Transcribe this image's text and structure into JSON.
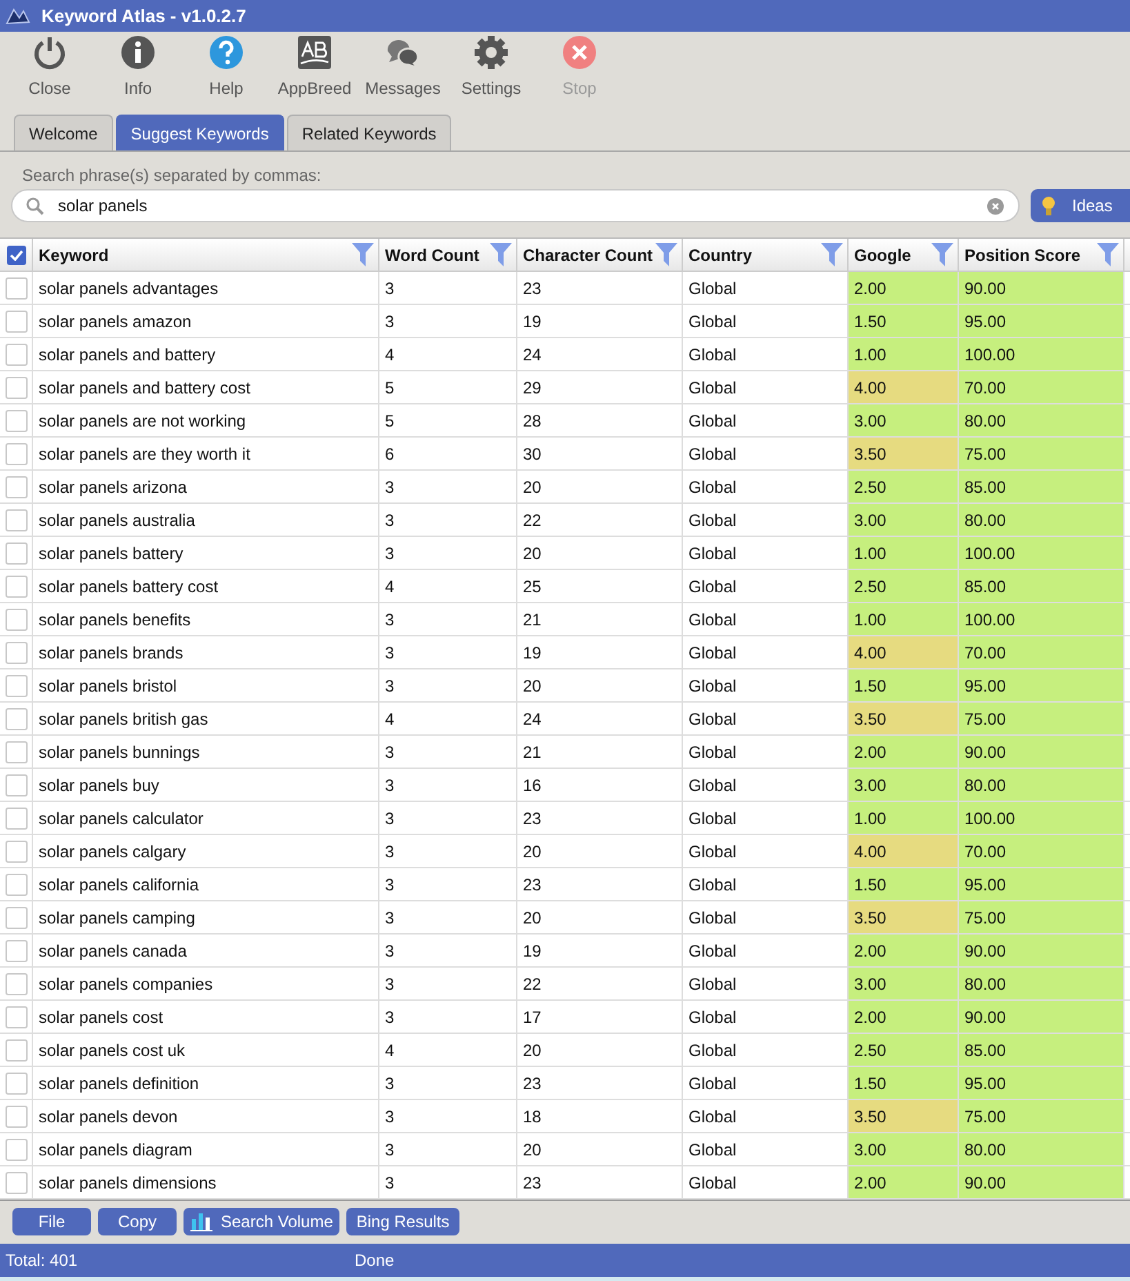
{
  "window": {
    "title": "Keyword Atlas - v1.0.2.7"
  },
  "toolbar": [
    {
      "label": "Close",
      "kind": "power",
      "disabled": false
    },
    {
      "label": "Info",
      "kind": "info",
      "disabled": false
    },
    {
      "label": "Help",
      "kind": "help",
      "disabled": false
    },
    {
      "label": "AppBreed",
      "kind": "appbreed",
      "disabled": false
    },
    {
      "label": "Messages",
      "kind": "messages",
      "disabled": false
    },
    {
      "label": "Settings",
      "kind": "settings",
      "disabled": false
    },
    {
      "label": "Stop",
      "kind": "stop",
      "disabled": true
    }
  ],
  "tabs": [
    {
      "label": "Welcome",
      "selected": false
    },
    {
      "label": "Suggest Keywords",
      "selected": true
    },
    {
      "label": "Related Keywords",
      "selected": false
    }
  ],
  "search": {
    "label": "Search phrase(s) separated by commas:",
    "value": "solar panels",
    "button": "Ideas"
  },
  "table": {
    "all_selected": true,
    "columns": [
      "Keyword",
      "Word Count",
      "Character Count",
      "Country",
      "Google",
      "Position Score"
    ],
    "rows": [
      {
        "selected": false,
        "cells": [
          "solar panels advantages",
          "3",
          "23",
          "Global",
          "2.00",
          "90.00"
        ],
        "color": "#c6ef7e"
      },
      {
        "selected": false,
        "cells": [
          "solar panels amazon",
          "3",
          "19",
          "Global",
          "1.50",
          "95.00"
        ],
        "color": "#c6ef7e"
      },
      {
        "selected": false,
        "cells": [
          "solar panels and battery",
          "4",
          "24",
          "Global",
          "1.00",
          "100.00"
        ],
        "color": "#c6ef7e"
      },
      {
        "selected": false,
        "cells": [
          "solar panels and battery cost",
          "5",
          "29",
          "Global",
          "4.00",
          "70.00"
        ],
        "color": "#e6db80"
      },
      {
        "selected": false,
        "cells": [
          "solar panels are not working",
          "5",
          "28",
          "Global",
          "3.00",
          "80.00"
        ],
        "color": "#c6ef7e"
      },
      {
        "selected": false,
        "cells": [
          "solar panels are they worth it",
          "6",
          "30",
          "Global",
          "3.50",
          "75.00"
        ],
        "color": "#e6db80"
      },
      {
        "selected": false,
        "cells": [
          "solar panels arizona",
          "3",
          "20",
          "Global",
          "2.50",
          "85.00"
        ],
        "color": "#c6ef7e"
      },
      {
        "selected": false,
        "cells": [
          "solar panels australia",
          "3",
          "22",
          "Global",
          "3.00",
          "80.00"
        ],
        "color": "#c6ef7e"
      },
      {
        "selected": false,
        "cells": [
          "solar panels battery",
          "3",
          "20",
          "Global",
          "1.00",
          "100.00"
        ],
        "color": "#c6ef7e"
      },
      {
        "selected": false,
        "cells": [
          "solar panels battery cost",
          "4",
          "25",
          "Global",
          "2.50",
          "85.00"
        ],
        "color": "#c6ef7e"
      },
      {
        "selected": false,
        "cells": [
          "solar panels benefits",
          "3",
          "21",
          "Global",
          "1.00",
          "100.00"
        ],
        "color": "#c6ef7e"
      },
      {
        "selected": false,
        "cells": [
          "solar panels brands",
          "3",
          "19",
          "Global",
          "4.00",
          "70.00"
        ],
        "color": "#e6db80"
      },
      {
        "selected": false,
        "cells": [
          "solar panels bristol",
          "3",
          "20",
          "Global",
          "1.50",
          "95.00"
        ],
        "color": "#c6ef7e"
      },
      {
        "selected": false,
        "cells": [
          "solar panels british gas",
          "4",
          "24",
          "Global",
          "3.50",
          "75.00"
        ],
        "color": "#e6db80"
      },
      {
        "selected": false,
        "cells": [
          "solar panels bunnings",
          "3",
          "21",
          "Global",
          "2.00",
          "90.00"
        ],
        "color": "#c6ef7e"
      },
      {
        "selected": false,
        "cells": [
          "solar panels buy",
          "3",
          "16",
          "Global",
          "3.00",
          "80.00"
        ],
        "color": "#c6ef7e"
      },
      {
        "selected": false,
        "cells": [
          "solar panels calculator",
          "3",
          "23",
          "Global",
          "1.00",
          "100.00"
        ],
        "color": "#c6ef7e"
      },
      {
        "selected": false,
        "cells": [
          "solar panels calgary",
          "3",
          "20",
          "Global",
          "4.00",
          "70.00"
        ],
        "color": "#e6db80"
      },
      {
        "selected": false,
        "cells": [
          "solar panels california",
          "3",
          "23",
          "Global",
          "1.50",
          "95.00"
        ],
        "color": "#c6ef7e"
      },
      {
        "selected": false,
        "cells": [
          "solar panels camping",
          "3",
          "20",
          "Global",
          "3.50",
          "75.00"
        ],
        "color": "#e6db80"
      },
      {
        "selected": false,
        "cells": [
          "solar panels canada",
          "3",
          "19",
          "Global",
          "2.00",
          "90.00"
        ],
        "color": "#c6ef7e"
      },
      {
        "selected": false,
        "cells": [
          "solar panels companies",
          "3",
          "22",
          "Global",
          "3.00",
          "80.00"
        ],
        "color": "#c6ef7e"
      },
      {
        "selected": false,
        "cells": [
          "solar panels cost",
          "3",
          "17",
          "Global",
          "2.00",
          "90.00"
        ],
        "color": "#c6ef7e"
      },
      {
        "selected": false,
        "cells": [
          "solar panels cost uk",
          "4",
          "20",
          "Global",
          "2.50",
          "85.00"
        ],
        "color": "#c6ef7e"
      },
      {
        "selected": false,
        "cells": [
          "solar panels definition",
          "3",
          "23",
          "Global",
          "1.50",
          "95.00"
        ],
        "color": "#c6ef7e"
      },
      {
        "selected": false,
        "cells": [
          "solar panels devon",
          "3",
          "18",
          "Global",
          "3.50",
          "75.00"
        ],
        "color": "#e6db80"
      },
      {
        "selected": false,
        "cells": [
          "solar panels diagram",
          "3",
          "20",
          "Global",
          "3.00",
          "80.00"
        ],
        "color": "#c6ef7e"
      },
      {
        "selected": false,
        "cells": [
          "solar panels dimensions",
          "3",
          "23",
          "Global",
          "2.00",
          "90.00"
        ],
        "color": "#c6ef7e"
      }
    ]
  },
  "buttons": [
    {
      "label": "File",
      "kind": "plain"
    },
    {
      "label": "Copy",
      "kind": "plain"
    },
    {
      "label": "Search Volume",
      "kind": "chart"
    },
    {
      "label": "Bing Results",
      "kind": "plain"
    }
  ],
  "status_bar": {
    "total": "Total: 401",
    "status": "Done"
  }
}
